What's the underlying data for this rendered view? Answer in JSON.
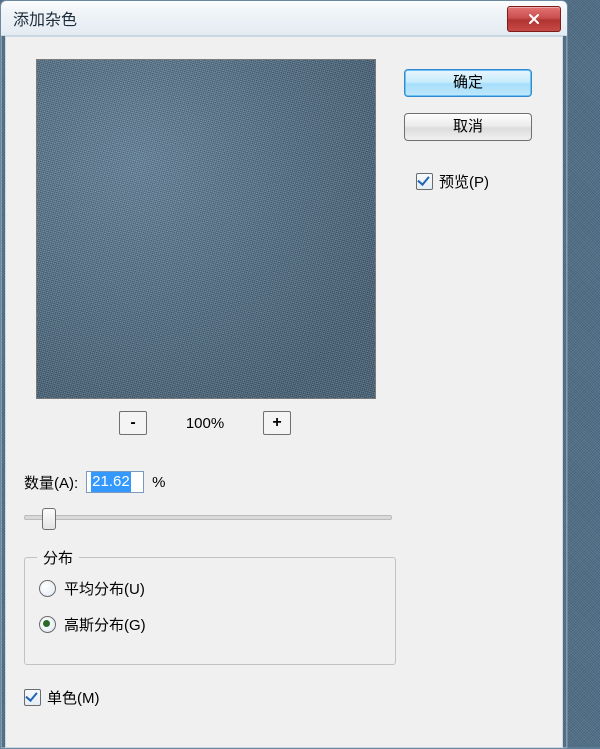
{
  "dialog": {
    "title": "添加杂色",
    "ok_label": "确定",
    "cancel_label": "取消",
    "preview_label": "预览(P)",
    "preview_checked": true
  },
  "zoom": {
    "minus": "-",
    "plus": "+",
    "level": "100%"
  },
  "amount": {
    "label": "数量(A):",
    "value": "21.62",
    "unit": "%"
  },
  "distribution": {
    "legend": "分布",
    "uniform_label": "平均分布(U)",
    "gaussian_label": "高斯分布(G)",
    "selected": "gaussian"
  },
  "monochrome": {
    "label": "单色(M)",
    "checked": true
  }
}
